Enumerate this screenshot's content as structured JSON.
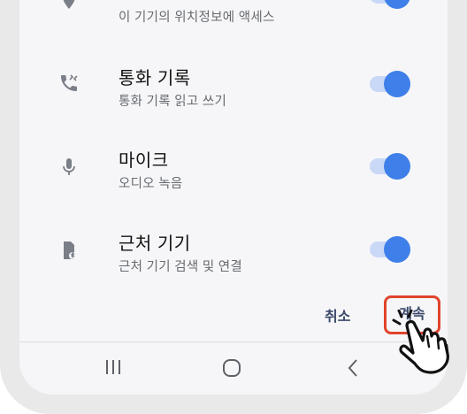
{
  "permissions": [
    {
      "title": "",
      "subtitle": "이 기기의 위치정보에 액세스",
      "enabled": true,
      "icon": "location-pin-icon"
    },
    {
      "title": "통화 기록",
      "subtitle": "통화 기록 읽고 쓰기",
      "enabled": true,
      "icon": "call-log-icon"
    },
    {
      "title": "마이크",
      "subtitle": "오디오 녹음",
      "enabled": true,
      "icon": "microphone-icon"
    },
    {
      "title": "근처 기기",
      "subtitle": "근처 기기 검색 및 연결",
      "enabled": true,
      "icon": "nearby-devices-icon"
    }
  ],
  "actions": {
    "cancel_label": "취소",
    "continue_label": "계속"
  },
  "navbar": {
    "recents": "recent-apps-icon",
    "home": "home-icon",
    "back": "back-icon"
  },
  "colors": {
    "accent": "#3f7fe9",
    "track": "#c9d8f7",
    "highlight": "#e0442c",
    "button_text": "#3c4a6b"
  }
}
